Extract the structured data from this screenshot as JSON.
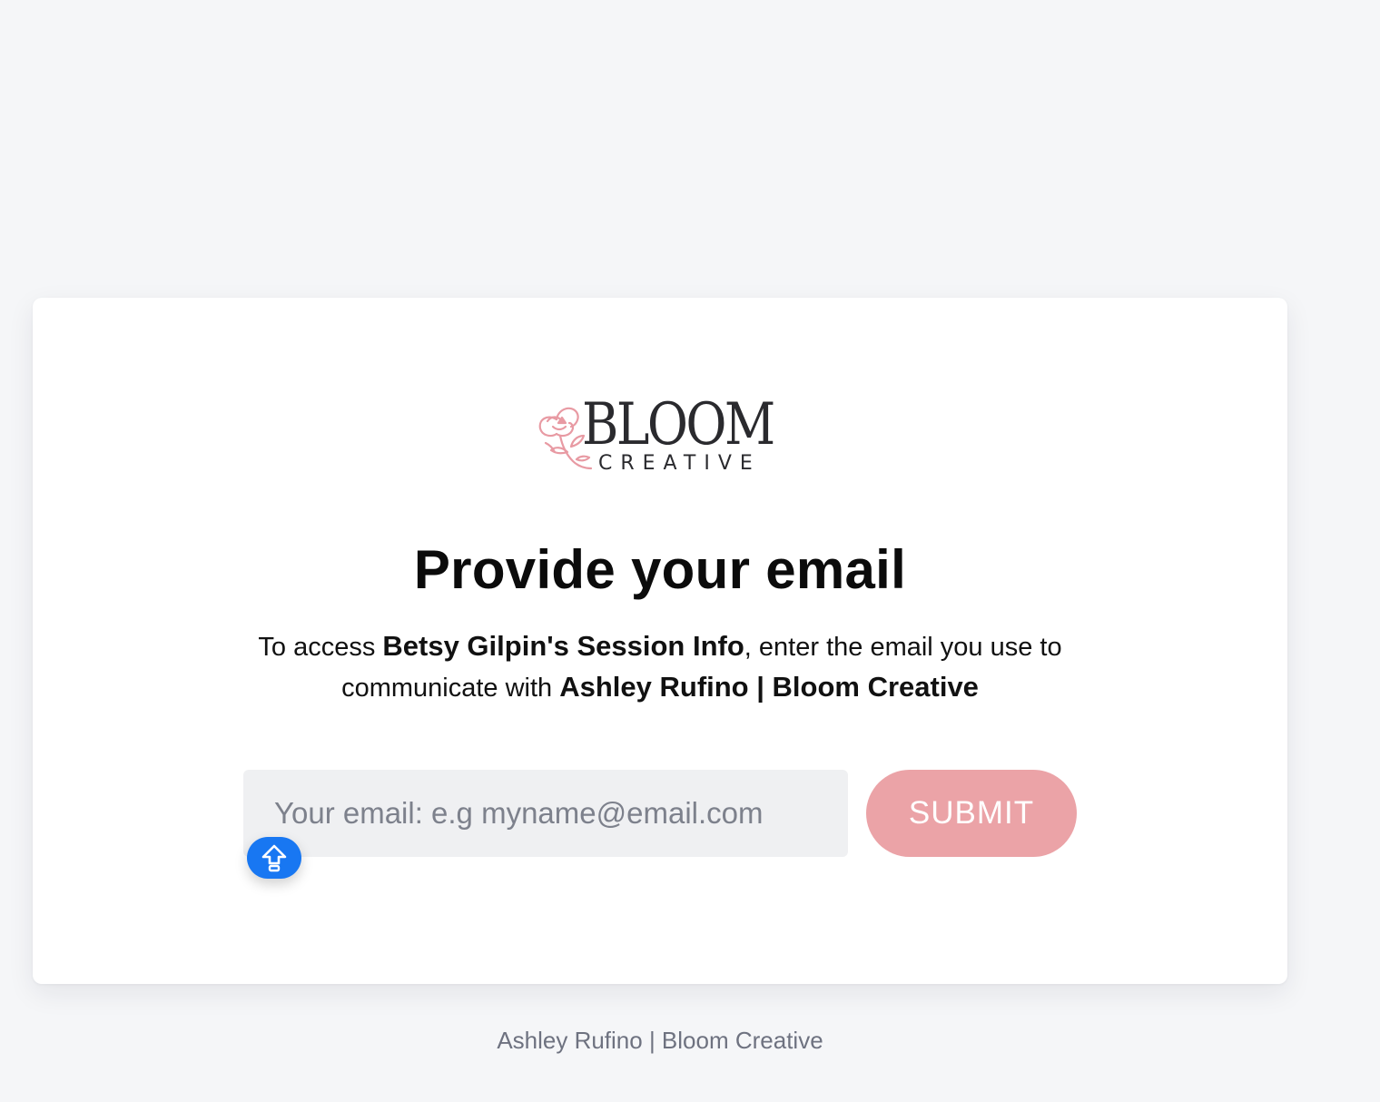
{
  "brand": {
    "logo_main": "BLOOM",
    "logo_sub": "CREATIVE",
    "accent_color": "#eba3a7"
  },
  "card": {
    "heading": "Provide your email",
    "description": {
      "prefix": "To access ",
      "resource": "Betsy Gilpin's Session Info",
      "middle": ", enter the email you use to communicate with ",
      "owner": "Ashley Rufino | Bloom Creative"
    },
    "email_field": {
      "placeholder": "Your email: e.g myname@email.com",
      "value": ""
    },
    "submit_label": "SUBMIT",
    "extension_badge_icon": "up-arrow-icon"
  },
  "footer": {
    "text": "Ashley Rufino | Bloom Creative"
  }
}
